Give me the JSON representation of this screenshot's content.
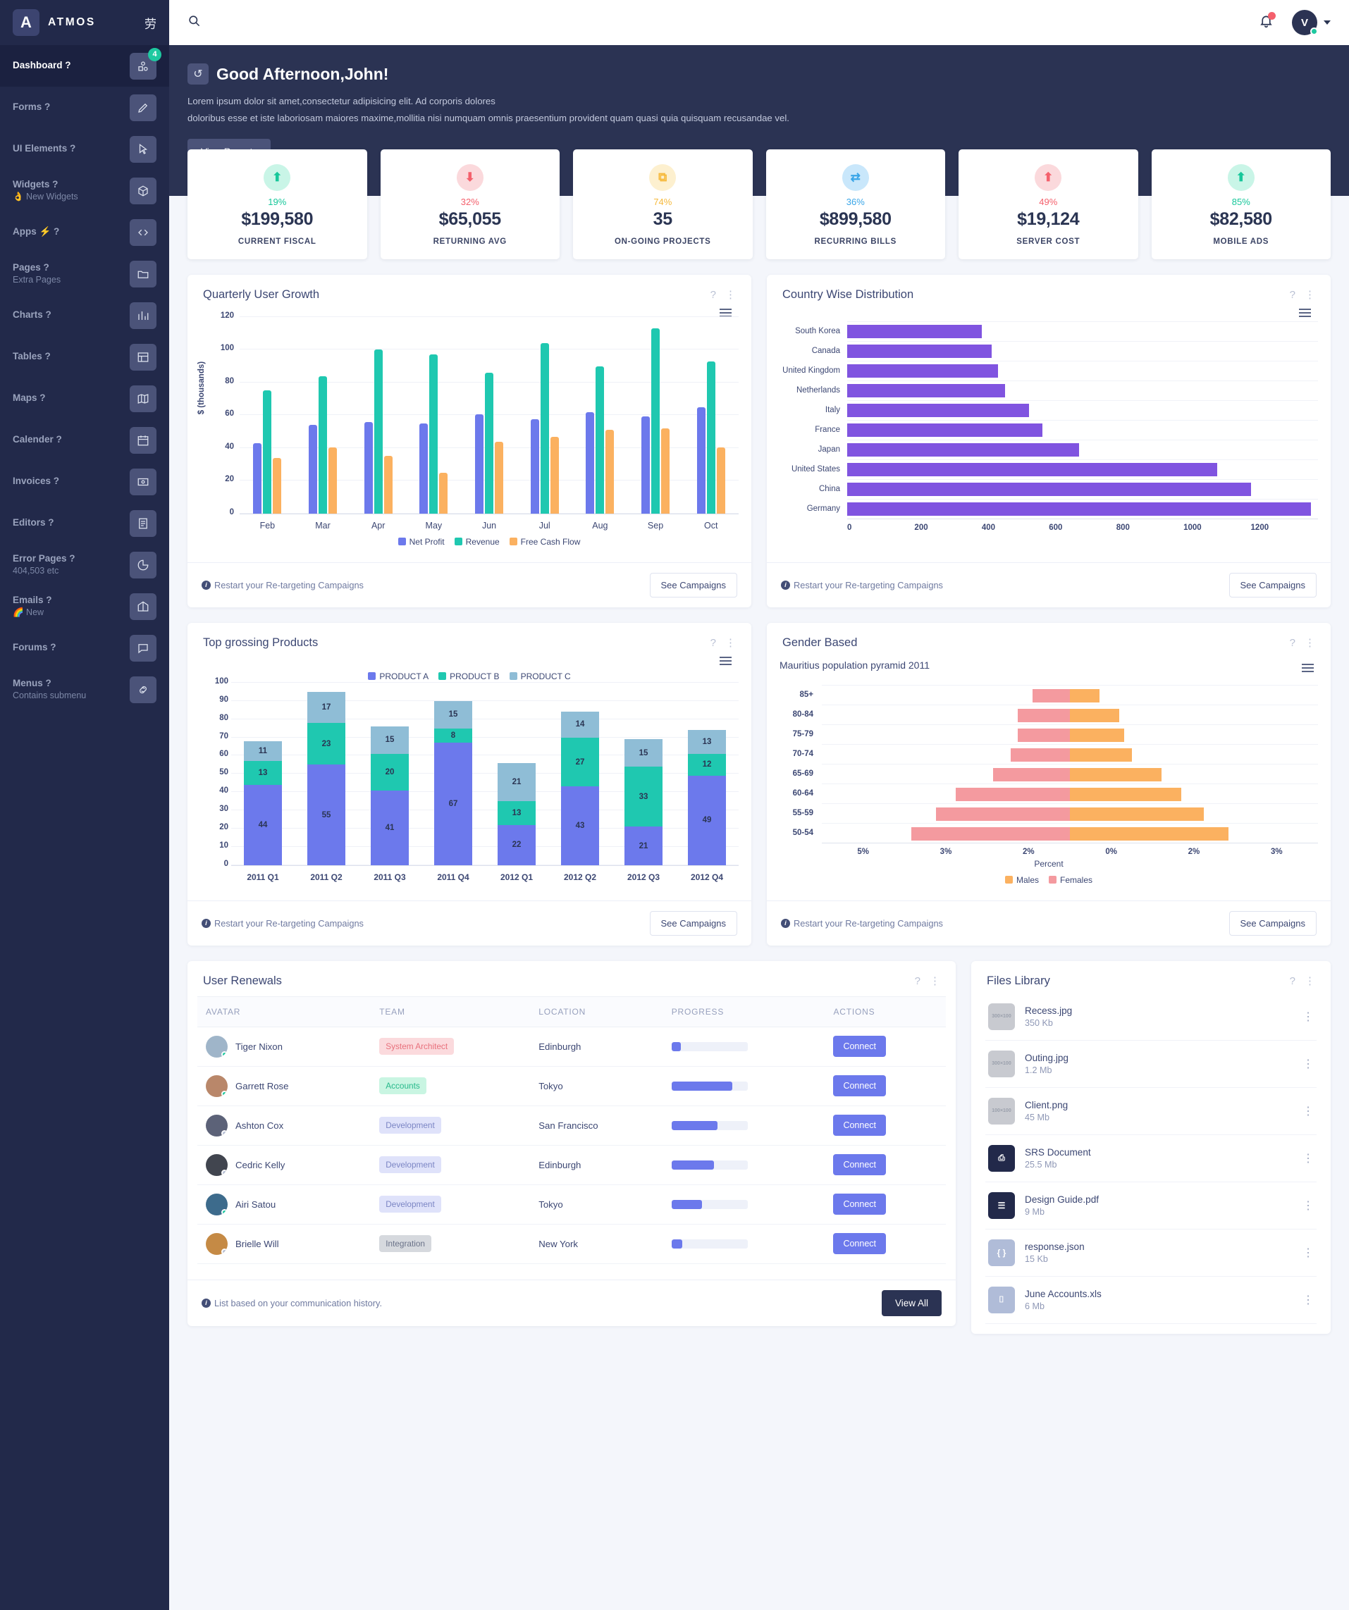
{
  "brand": {
    "logo_letter": "A",
    "name": "ATMOS",
    "toggle_icon": "menu-toggle-icon"
  },
  "sidebar": {
    "items": [
      {
        "label": "Dashboard ?",
        "sub": "",
        "icon": "shapes-icon",
        "badge": "4",
        "active": true
      },
      {
        "label": "Forms ?",
        "sub": "",
        "icon": "pencil-icon",
        "badge": "",
        "active": false
      },
      {
        "label": "UI Elements ?",
        "sub": "",
        "icon": "cursor-icon",
        "badge": "",
        "active": false
      },
      {
        "label": "Widgets ?",
        "sub": "👌 New Widgets",
        "icon": "box-icon",
        "badge": "",
        "active": false
      },
      {
        "label": "Apps ⚡ ?",
        "sub": "",
        "icon": "code-icon",
        "badge": "",
        "active": false
      },
      {
        "label": "Pages ?",
        "sub": "Extra Pages",
        "icon": "folder-icon",
        "badge": "",
        "active": false
      },
      {
        "label": "Charts ?",
        "sub": "",
        "icon": "chart-icon",
        "badge": "",
        "active": false
      },
      {
        "label": "Tables ?",
        "sub": "",
        "icon": "table-icon",
        "badge": "",
        "active": false
      },
      {
        "label": "Maps ?",
        "sub": "",
        "icon": "map-icon",
        "badge": "",
        "active": false
      },
      {
        "label": "Calender ?",
        "sub": "",
        "icon": "calendar-icon",
        "badge": "",
        "active": false
      },
      {
        "label": "Invoices ?",
        "sub": "",
        "icon": "invoice-icon",
        "badge": "",
        "active": false
      },
      {
        "label": "Editors ?",
        "sub": "",
        "icon": "document-icon",
        "badge": "",
        "active": false
      },
      {
        "label": "Error Pages ?",
        "sub": "404,503 etc",
        "icon": "pie-slice-icon",
        "badge": "",
        "active": false
      },
      {
        "label": "Emails ?",
        "sub": "🌈 New",
        "icon": "mail-open-icon",
        "badge": "",
        "active": false
      },
      {
        "label": "Forums ?",
        "sub": "",
        "icon": "chat-icon",
        "badge": "",
        "active": false
      },
      {
        "label": "Menus ?",
        "sub": "Contains submenu",
        "icon": "link-icon",
        "badge": "",
        "active": false
      }
    ]
  },
  "topbar": {
    "search_placeholder": "",
    "search_value": "",
    "search_icon": "search-icon",
    "bell_icon": "bell-icon",
    "avatar_initial": "V",
    "caret_icon": "chevron-down-icon"
  },
  "hero": {
    "refresh_icon": "refresh-icon",
    "title": "Good Afternoon,John!",
    "line1": "Lorem ipsum dolor sit amet,consectetur adipisicing elit. Ad corporis dolores",
    "line2": "doloribus esse et iste laboriosam maiores maxime,mollitia nisi numquam omnis praesentium provident quam quasi quia quisquam recusandae vel.",
    "button": "View Reports"
  },
  "stats": [
    {
      "icon": "arrow-up-icon",
      "glyph": "⬆",
      "pct": "19%",
      "value": "$199,580",
      "label": "CURRENT FISCAL",
      "color": "#16c79a",
      "bg": "#c9f5e7"
    },
    {
      "icon": "arrow-down-icon",
      "glyph": "⬇",
      "pct": "32%",
      "value": "$65,055",
      "label": "RETURNING AVG",
      "color": "#f4606c",
      "bg": "#fbd9dc"
    },
    {
      "icon": "projects-icon",
      "glyph": "⧉",
      "pct": "74%",
      "value": "35",
      "label": "ON-GOING PROJECTS",
      "color": "#f6b93b",
      "bg": "#fdf0cf"
    },
    {
      "icon": "recurring-icon",
      "glyph": "⇄",
      "pct": "36%",
      "value": "$899,580",
      "label": "RECURRING BILLS",
      "color": "#3aa6e8",
      "bg": "#c9e7fb"
    },
    {
      "icon": "arrow-up-icon",
      "glyph": "⬆",
      "pct": "49%",
      "value": "$19,124",
      "label": "SERVER COST",
      "color": "#f4606c",
      "bg": "#fbd9dc"
    },
    {
      "icon": "arrow-up-icon",
      "glyph": "⬆",
      "pct": "85%",
      "value": "$82,580",
      "label": "MOBILE ADS",
      "color": "#16c79a",
      "bg": "#c9f5e7"
    }
  ],
  "cards": {
    "quarterly": {
      "title": "Quarterly User Growth",
      "help_icon": "help-icon",
      "menu_icon": "kebab-menu-icon",
      "export_icon": "export-menu-icon"
    },
    "country": {
      "title": "Country Wise Distribution",
      "help_icon": "help-icon",
      "menu_icon": "kebab-menu-icon",
      "export_icon": "export-menu-icon"
    },
    "products": {
      "title": "Top grossing Products",
      "help_icon": "help-icon",
      "menu_icon": "kebab-menu-icon",
      "export_icon": "export-menu-icon"
    },
    "gender": {
      "title": "Gender Based",
      "help_icon": "help-icon",
      "menu_icon": "kebab-menu-icon",
      "export_icon": "export-menu-icon"
    },
    "footer_note": "Restart your Re-targeting Campaigns",
    "footer_button": "See Campaigns",
    "info_icon": "info-icon"
  },
  "chart_data": [
    {
      "type": "bar",
      "title": "Quarterly User Growth",
      "categories": [
        "Feb",
        "Mar",
        "Apr",
        "May",
        "Jun",
        "Jul",
        "Aug",
        "Sep",
        "Oct"
      ],
      "series": [
        {
          "name": "Net Profit",
          "color": "#6c79ec",
          "values": [
            43,
            54,
            56,
            55,
            60.5,
            57.5,
            62,
            59.5,
            65
          ]
        },
        {
          "name": "Revenue",
          "color": "#1fc8b0",
          "values": [
            75,
            84,
            100,
            97,
            86,
            104,
            90,
            113,
            93
          ]
        },
        {
          "name": "Free Cash Flow",
          "color": "#fbb160",
          "values": [
            34,
            40.5,
            35,
            25,
            44,
            47,
            51,
            52,
            40.5
          ]
        }
      ],
      "xlabel": "",
      "ylabel": "$ (thousands)",
      "ylim": [
        0,
        120
      ],
      "yticks": [
        0,
        20,
        40,
        60,
        80,
        100,
        120
      ],
      "grid": true,
      "legend_position": "bottom"
    },
    {
      "type": "bar",
      "orientation": "horizontal",
      "title": "Country Wise Distribution",
      "categories": [
        "South Korea",
        "Canada",
        "United Kingdom",
        "Netherlands",
        "Italy",
        "France",
        "Japan",
        "United States",
        "China",
        "Germany"
      ],
      "values": [
        400,
        430,
        448,
        470,
        540,
        580,
        690,
        1100,
        1200,
        1380
      ],
      "color": "#8054e0",
      "xlabel": "",
      "ylabel": "",
      "xlim": [
        0,
        1400
      ],
      "xticks": [
        0,
        200,
        400,
        600,
        800,
        1000,
        1200
      ],
      "grid": true,
      "legend_position": "none"
    },
    {
      "type": "bar",
      "stacked": true,
      "title": "Top grossing Products",
      "categories": [
        "2011 Q1",
        "2011 Q2",
        "2011 Q3",
        "2011 Q4",
        "2012 Q1",
        "2012 Q2",
        "2012 Q3",
        "2012 Q4"
      ],
      "series": [
        {
          "name": "PRODUCT A",
          "color": "#6c79ec",
          "values": [
            44,
            55,
            41,
            67,
            22,
            43,
            21,
            49
          ]
        },
        {
          "name": "PRODUCT B",
          "color": "#1fc8b0",
          "values": [
            13,
            23,
            20,
            8,
            13,
            27,
            33,
            12
          ]
        },
        {
          "name": "PRODUCT C",
          "color": "#8fbdd6",
          "values": [
            11,
            17,
            15,
            15,
            21,
            14,
            15,
            13
          ]
        }
      ],
      "xlabel": "",
      "ylabel": "",
      "ylim": [
        0,
        100
      ],
      "yticks": [
        0,
        10,
        20,
        30,
        40,
        50,
        60,
        70,
        80,
        90,
        100
      ],
      "grid": true,
      "legend_position": "top"
    },
    {
      "type": "bar",
      "orientation": "horizontal",
      "diverging": true,
      "title": "Mauritius population pyramid 2011",
      "categories": [
        "85+",
        "80-84",
        "75-79",
        "70-74",
        "65-69",
        "60-64",
        "55-59",
        "50-54"
      ],
      "series": [
        {
          "name": "Males",
          "color": "#fbb160",
          "values": [
            0.6,
            1.0,
            1.1,
            1.25,
            1.85,
            2.25,
            2.7,
            3.2
          ]
        },
        {
          "name": "Females",
          "color": "#f49a9f",
          "values": [
            0.75,
            1.05,
            1.05,
            1.2,
            1.55,
            2.3,
            2.7,
            3.2
          ]
        }
      ],
      "xlabel": "Percent",
      "ylabel": "",
      "xticks": [
        "5%",
        "3%",
        "2%",
        "0%",
        "2%",
        "3%"
      ],
      "grid": true,
      "legend_position": "bottom"
    }
  ],
  "renewals": {
    "title": "User Renewals",
    "help_icon": "help-icon",
    "menu_icon": "kebab-menu-icon",
    "columns": [
      "AVATAR",
      "TEAM",
      "LOCATION",
      "PROGRESS",
      "ACTIONS"
    ],
    "rows": [
      {
        "name": "Tiger Nixon",
        "team": "System Architect",
        "team_bg": "#fbdadd",
        "team_fg": "#e8707c",
        "location": "Edinburgh",
        "progress": 12,
        "action": "Connect",
        "status": "#1ec9a0"
      },
      {
        "name": "Garrett Rose",
        "team": "Accounts",
        "team_bg": "#c9f5e2",
        "team_fg": "#27b98b",
        "location": "Tokyo",
        "progress": 80,
        "action": "Connect",
        "status": "#1ec9a0"
      },
      {
        "name": "Ashton Cox",
        "team": "Development",
        "team_bg": "#dfe2fa",
        "team_fg": "#7b85c4",
        "location": "San Francisco",
        "progress": 60,
        "action": "Connect",
        "status": "#b7c0d6"
      },
      {
        "name": "Cedric Kelly",
        "team": "Development",
        "team_bg": "#dfe2fa",
        "team_fg": "#7b85c4",
        "location": "Edinburgh",
        "progress": 56,
        "action": "Connect",
        "status": "#b7c0d6"
      },
      {
        "name": "Airi Satou",
        "team": "Development",
        "team_bg": "#dfe2fa",
        "team_fg": "#7b85c4",
        "location": "Tokyo",
        "progress": 40,
        "action": "Connect",
        "status": "#1ec9a0"
      },
      {
        "name": "Brielle Will",
        "team": "Integration",
        "team_bg": "#d6d9de",
        "team_fg": "#6b7389",
        "location": "New York",
        "progress": 14,
        "action": "Connect",
        "status": "#b7c0d6"
      }
    ],
    "footer_note": "List based on your communication history.",
    "footer_button": "View All",
    "info_icon": "info-icon"
  },
  "files": {
    "title": "Files Library",
    "help_icon": "help-icon",
    "menu_icon": "kebab-menu-icon",
    "items": [
      {
        "name": "Recess.jpg",
        "size": "350 Kb",
        "thumb": "image-placeholder-icon",
        "thumb_bg": "#c8cad0",
        "thumb_fg": "#9aa0ac",
        "glyph": "300×100"
      },
      {
        "name": "Outing.jpg",
        "size": "1.2 Mb",
        "thumb": "image-placeholder-icon",
        "thumb_bg": "#c8cad0",
        "thumb_fg": "#9aa0ac",
        "glyph": "300×100"
      },
      {
        "name": "Client.png",
        "size": "45 Mb",
        "thumb": "image-placeholder-icon",
        "thumb_bg": "#c8cad0",
        "thumb_fg": "#9aa0ac",
        "glyph": "100×100"
      },
      {
        "name": "SRS Document",
        "size": "25.5 Mb",
        "thumb": "pdf-file-icon",
        "thumb_bg": "#22294a",
        "thumb_fg": "#ffffff",
        "glyph": "⎙"
      },
      {
        "name": "Design Guide.pdf",
        "size": "9 Mb",
        "thumb": "document-file-icon",
        "thumb_bg": "#22294a",
        "thumb_fg": "#ffffff",
        "glyph": "☰"
      },
      {
        "name": "response.json",
        "size": "15 Kb",
        "thumb": "json-file-icon",
        "thumb_bg": "#b0bcd8",
        "thumb_fg": "#ffffff",
        "glyph": "{ }"
      },
      {
        "name": "June Accounts.xls",
        "size": "6 Mb",
        "thumb": "excel-file-icon",
        "thumb_bg": "#b0bcd8",
        "thumb_fg": "#ffffff",
        "glyph": "⌷"
      }
    ]
  }
}
